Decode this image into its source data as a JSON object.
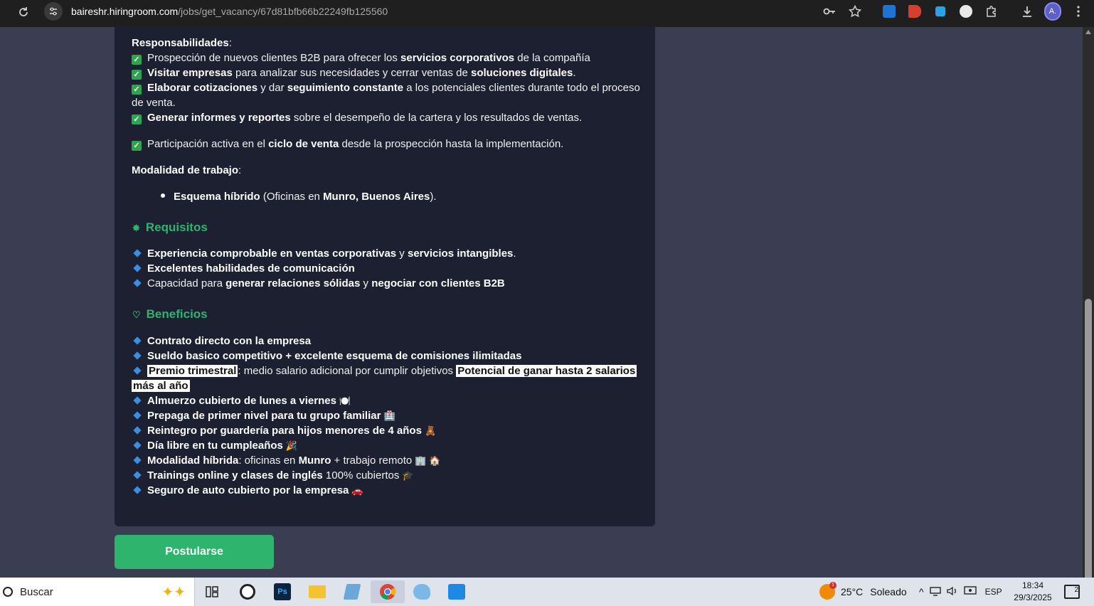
{
  "browser": {
    "url_host": "baireshr.hiringroom.com",
    "url_path": "/jobs/get_vacancy/67d81bfb66b22249fb125560",
    "avatar_initial": "A."
  },
  "content": {
    "resp_title": "Responsabilidades",
    "colon": ":",
    "resp_items": [
      {
        "pre": "Prospección de nuevos clientes B2B para ofrecer los ",
        "b1": "servicios corporativos",
        "post": " de la compañía"
      },
      {
        "b1": "Visitar empresas",
        "mid": " para analizar sus necesidades y cerrar ventas de ",
        "b2": "soluciones digitales",
        "post": "."
      },
      {
        "b1": "Elaborar cotizaciones",
        "mid": " y dar ",
        "b2": "seguimiento constante",
        "post": " a los potenciales clientes durante todo el proceso",
        "cont": "de venta."
      },
      {
        "b1": "Generar informes y reportes",
        "post": " sobre el desempeño de la cartera y los resultados de ventas."
      },
      {
        "pre": "Participación activa en el ",
        "b1": "ciclo de venta",
        "post": " desde la prospección hasta la implementación."
      }
    ],
    "modalidad_title": "Modalidad de trabajo",
    "modalidad_item": {
      "b1": "Esquema híbrido",
      "mid": " (Oficinas en ",
      "b2": "Munro, Buenos Aires",
      "post": ")."
    },
    "req_title": "Requisitos",
    "req_items": [
      {
        "b1": "Experiencia comprobable en ventas corporativas",
        "mid": " y ",
        "b2": "servicios intangibles",
        "post": "."
      },
      {
        "b1": "Excelentes habilidades de comunicación"
      },
      {
        "pre": "Capacidad para ",
        "b1": "generar relaciones sólidas",
        "mid": " y ",
        "b2": "negociar con clientes B2B"
      }
    ],
    "ben_title": "Beneficios",
    "ben_items": [
      {
        "b1": "Contrato directo con la empresa"
      },
      {
        "b1": "Sueldo basico competitivo + excelente esquema de comisiones ilimitadas"
      },
      {
        "hl1": "Premio trimestral",
        "mid": ": medio salario adicional por cumplir objetivos ",
        "hl2": "Potencial de ganar hasta 2 salarios",
        "hl3": "más al año"
      },
      {
        "b1": "Almuerzo cubierto de lunes a viernes",
        "emoji": "🍽️"
      },
      {
        "b1": "Prepaga de primer nivel para tu grupo familiar",
        "emoji": "🏥"
      },
      {
        "b1": "Reintegro por guardería para hijos menores de 4 años",
        "emoji": "🧸"
      },
      {
        "b1": "Día libre en tu cumpleaños",
        "emoji": "🎉"
      },
      {
        "b1": "Modalidad híbrida",
        "mid": ": oficinas en ",
        "b2": "Munro",
        "post": " + trabajo remoto",
        "emoji": "🏢 🏠"
      },
      {
        "b1": "Trainings online y clases de inglés",
        "post": " 100% cubiertos",
        "emoji": "🎓"
      },
      {
        "b1": "Seguro de auto cubierto por la empresa",
        "emoji": "🚗"
      }
    ],
    "apply_label": "Postularse"
  },
  "taskbar": {
    "search_label": "Buscar",
    "weather_temp": "25°C",
    "weather_desc": "Soleado",
    "weather_badge": "1",
    "lang": "ESP",
    "time": "18:34",
    "date": "29/3/2025",
    "notif_count": "2"
  },
  "colors": {
    "accent_green": "#2fb46e",
    "panel_bg": "#1d2030",
    "page_bg": "#3b3d52"
  }
}
